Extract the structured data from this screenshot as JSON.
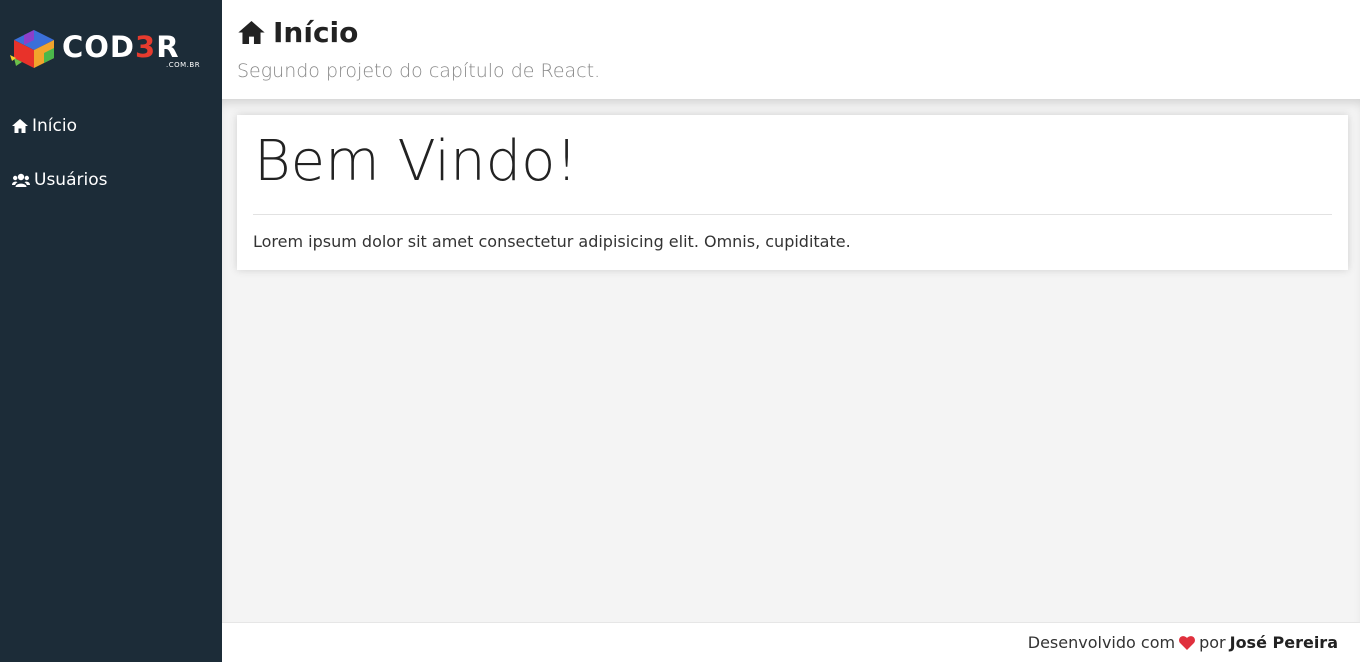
{
  "logo": {
    "text_main": "COD",
    "text_accent": "3",
    "text_end": "R",
    "sub": ".COM.BR"
  },
  "menu": {
    "items": [
      {
        "label": "Início",
        "icon": "home-icon"
      },
      {
        "label": "Usuários",
        "icon": "users-icon"
      }
    ]
  },
  "header": {
    "icon": "home-icon",
    "title": "Início",
    "subtitle": "Segundo projeto do capítulo de React."
  },
  "main": {
    "card_title": "Bem Vindo!",
    "card_text": "Lorem ipsum dolor sit amet consectetur adipisicing elit. Omnis, cupiditate."
  },
  "footer": {
    "prefix": "Desenvolvido com",
    "icon": "heart-icon",
    "middle": "por",
    "author": "José Pereira"
  },
  "colors": {
    "sidebar_bg": "#1c2c38",
    "content_bg": "#f4f4f4",
    "heart": "#e0303d",
    "logo_accent": "#e63b2e"
  }
}
